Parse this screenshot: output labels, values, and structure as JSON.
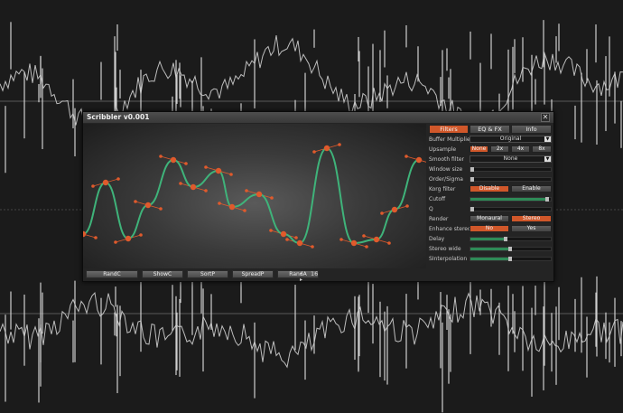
{
  "window": {
    "title": "Scribbler v0.001",
    "close_label": "✕"
  },
  "bottom_buttons": [
    "RandC",
    "ShowC",
    "SortP",
    "SpreadP",
    "RandA"
  ],
  "arrows_label": "◂ ▸",
  "point_count": "16",
  "tabs": [
    {
      "label": "Filters",
      "active": true
    },
    {
      "label": "EQ & FX",
      "active": false
    },
    {
      "label": "Info",
      "active": false
    }
  ],
  "controls": {
    "buffer_multiplier": {
      "label": "Buffer Multiplier",
      "value": "Original"
    },
    "upsample": {
      "label": "Upsample",
      "options": [
        "None",
        "2x",
        "4x",
        "8x"
      ],
      "selected": "None"
    },
    "smooth_filter": {
      "label": "Smooth filter",
      "value": "None"
    },
    "window_size": {
      "label": "Window size",
      "level": 0.0
    },
    "order_sigma": {
      "label": "Order/Sigma",
      "level": 0.0
    },
    "korg_filter": {
      "label": "Korg filter",
      "options": [
        "Disable",
        "Enable"
      ],
      "selected": "Disable"
    },
    "cutoff": {
      "label": "Cutoff",
      "level": 1.0
    },
    "q": {
      "label": "Q",
      "level": 0.0
    },
    "render": {
      "label": "Render",
      "options": [
        "Monaural",
        "Stereo"
      ],
      "selected": "Stereo"
    },
    "enhance_stereo": {
      "label": "Enhance stereo",
      "options": [
        "No",
        "Yes"
      ],
      "selected": "No"
    },
    "delay": {
      "label": "Delay",
      "level": 0.45
    },
    "stereo_wide": {
      "label": "Stereo wide",
      "level": 0.5
    },
    "sinterpolation": {
      "label": "SInterpolation",
      "level": 0.5
    }
  },
  "colors": {
    "accent": "#d0572a",
    "curve": "#3fb37a",
    "handle": "#e05a2c",
    "slider_fill": "#2e8b57"
  }
}
